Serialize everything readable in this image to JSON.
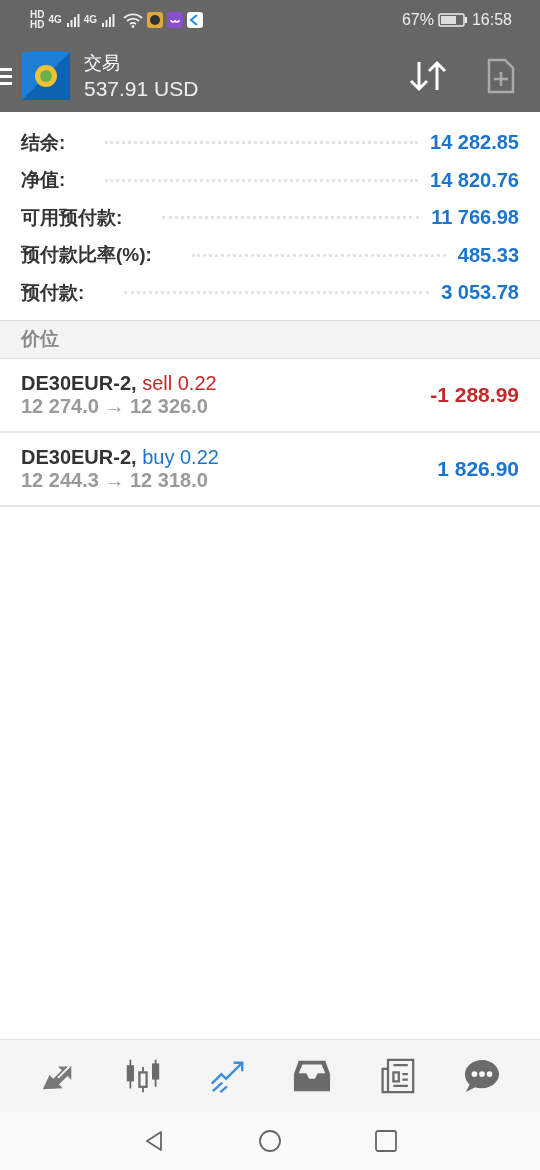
{
  "status_bar": {
    "sim_labels": [
      "HD",
      "HD"
    ],
    "network_labels": [
      "4G",
      "4G"
    ],
    "battery": "67%",
    "time": "16:58"
  },
  "toolbar": {
    "title": "交易",
    "balance": "537.91 USD"
  },
  "summary": [
    {
      "label": "结余:",
      "value": "14 282.85"
    },
    {
      "label": "净值:",
      "value": "14 820.76"
    },
    {
      "label": "可用预付款:",
      "value": "11 766.98"
    },
    {
      "label": "预付款比率(%):",
      "value": "485.33"
    },
    {
      "label": "预付款:",
      "value": "3 053.78"
    }
  ],
  "section_header": "价位",
  "positions": [
    {
      "symbol": "DE30EUR-2,",
      "kind": "sell",
      "order": "sell 0.22",
      "prices": "12 274.0 → 12 326.0",
      "profit": "-1 288.99"
    },
    {
      "symbol": "DE30EUR-2,",
      "kind": "buy",
      "order": "buy 0.22",
      "prices": "12 244.3 → 12 318.0",
      "profit": "1 826.90"
    }
  ],
  "bottom_nav": [
    {
      "kind": "quotes",
      "selected": false
    },
    {
      "kind": "chart",
      "selected": false
    },
    {
      "kind": "trade",
      "selected": true
    },
    {
      "kind": "history",
      "selected": false
    },
    {
      "kind": "news",
      "selected": false
    },
    {
      "kind": "chat",
      "selected": false
    }
  ]
}
